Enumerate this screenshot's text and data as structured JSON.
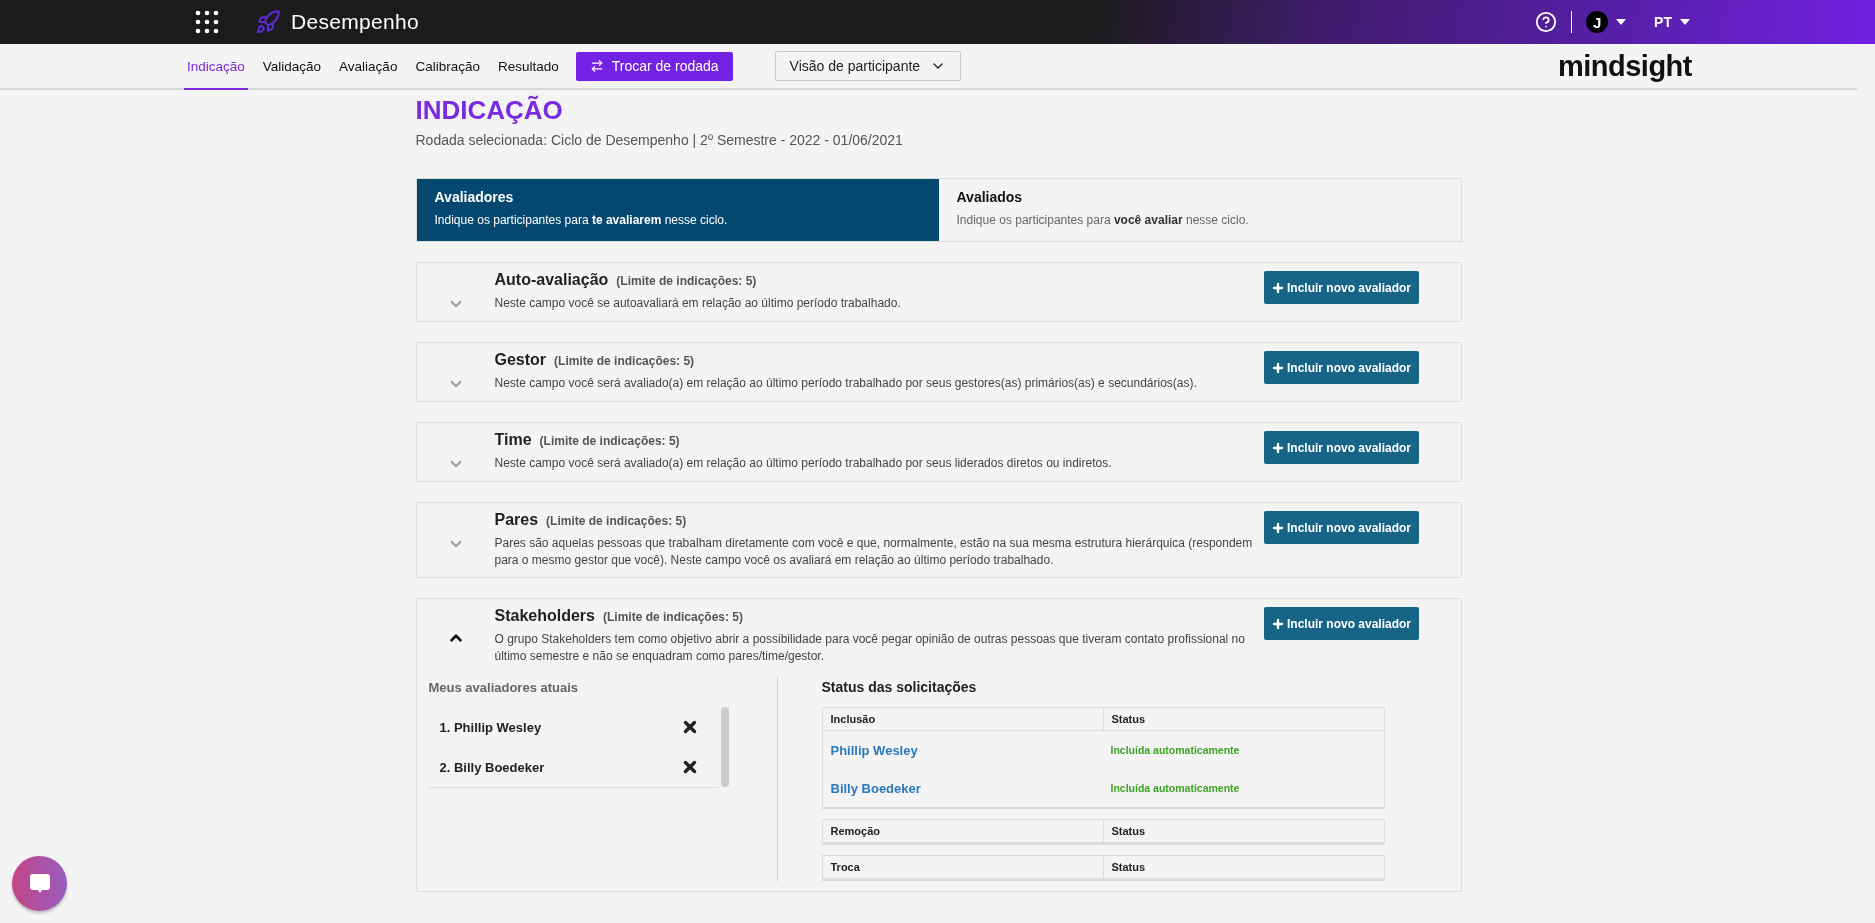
{
  "app_bar": {
    "title": "Desempenho",
    "user_initial": "J",
    "language": "PT"
  },
  "nav": {
    "tabs": [
      {
        "label": "Indicação",
        "selected": true
      },
      {
        "label": "Validação",
        "selected": false
      },
      {
        "label": "Avaliação",
        "selected": false
      },
      {
        "label": "Calibração",
        "selected": false
      },
      {
        "label": "Resultado",
        "selected": false
      }
    ],
    "switch_button": "Trocar de rodada",
    "view_select": "Visão de participante",
    "logo": "mindsight"
  },
  "page": {
    "title": "INDICAÇÃO",
    "subtitle": "Rodada selecionada: Ciclo de Desempenho | 2º Semestre - 2022 - 01/06/2021"
  },
  "mode_tabs": [
    {
      "title": "Avaliadores",
      "description": "Indique os participantes para **te avaliarem** nesse ciclo.",
      "selected": true
    },
    {
      "title": "Avaliados",
      "description": "Indique os participantes para **você avaliar** nesse ciclo.",
      "selected": false
    }
  ],
  "sections": [
    {
      "title": "Auto-avaliação",
      "limit": "(Limite de indicações: 5)",
      "description": "Neste campo você se autoavaliará em relação ao último período trabalhado.",
      "button": "Incluir novo avaliador",
      "expanded": false
    },
    {
      "title": "Gestor",
      "limit": "(Limite de indicações: 5)",
      "description": "Neste campo você será avaliado(a) em relação ao último período trabalhado por seus gestores(as) primários(as) e secundários(as).",
      "button": "Incluir novo avaliador",
      "expanded": false
    },
    {
      "title": "Time",
      "limit": "(Limite de indicações: 5)",
      "description": "Neste campo você será avaliado(a) em relação ao último período trabalhado por seus liderados diretos ou indiretos.",
      "button": "Incluir novo avaliador",
      "expanded": false
    },
    {
      "title": "Pares",
      "limit": "(Limite de indicações: 5)",
      "description": "Pares são aquelas pessoas que trabalham diretamente com você e que, normalmente, estão na sua mesma estrutura hierárquica (respondem para o mesmo gestor que você). Neste campo você os avaliará em relação ao último período trabalhado.",
      "button": "Incluir novo avaliador",
      "expanded": false
    },
    {
      "title": "Stakeholders",
      "limit": "(Limite de indicações: 5)",
      "description": "O grupo Stakeholders tem como objetivo abrir a possibilidade para você pegar opinião de outras pessoas que tiveram contato profissional no último semestre e não se enquadram como pares/time/gestor.",
      "button": "Incluir novo avaliador",
      "expanded": true,
      "details": {
        "current_label": "Meus avaliadores atuais",
        "evaluators": [
          "1. Phillip Wesley",
          "2. Billy Boedeker"
        ],
        "status_title": "Status das solicitações",
        "tables": [
          {
            "columns": [
              "Inclusão",
              "Status"
            ],
            "rows": [
              {
                "name": "Phillip Wesley",
                "status": "Incluída automaticamente"
              },
              {
                "name": "Billy Boedeker",
                "status": "Incluída automaticamente"
              }
            ]
          },
          {
            "columns": [
              "Remoção",
              "Status"
            ]
          },
          {
            "columns": [
              "Troca",
              "Status"
            ]
          }
        ]
      }
    }
  ]
}
